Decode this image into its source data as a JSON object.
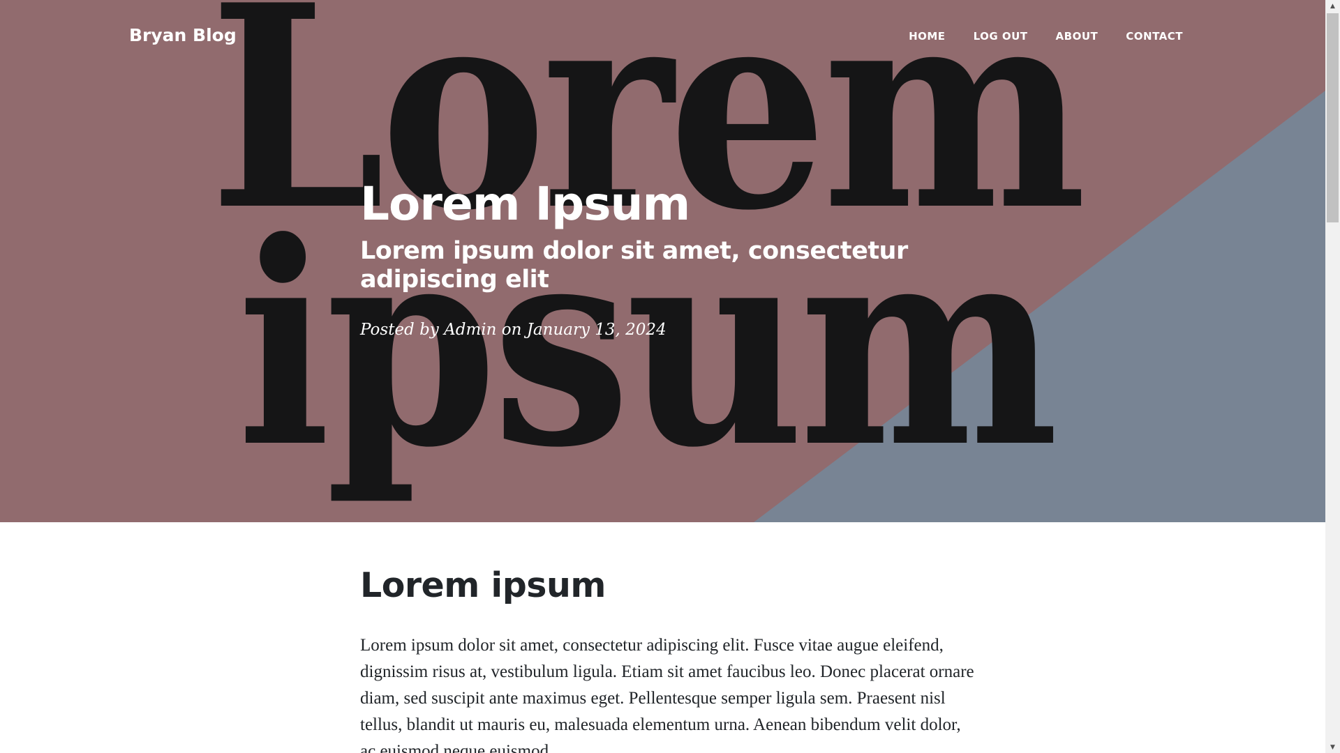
{
  "colors": {
    "hero_mauve": "#916B6E",
    "hero_slate": "#788494",
    "hero_letters": "#151516",
    "text_white": "#ffffff",
    "body_text": "#212529"
  },
  "hero_art": {
    "line1": "Lorem",
    "line2": "ipsum"
  },
  "navbar": {
    "brand": "Bryan Blog",
    "links": [
      {
        "label": "HOME"
      },
      {
        "label": "LOG OUT"
      },
      {
        "label": "ABOUT"
      },
      {
        "label": "CONTACT"
      }
    ]
  },
  "post": {
    "title": "Lorem Ipsum",
    "subtitle": "Lorem ipsum dolor sit amet, consectetur adipiscing elit",
    "meta": "Posted by Admin on January 13, 2024"
  },
  "content": {
    "heading": "Lorem ipsum",
    "paragraph": "Lorem ipsum dolor sit amet, consectetur adipiscing elit. Fusce vitae augue eleifend, dignissim risus at, vestibulum ligula. Etiam sit amet faucibus leo. Donec placerat ornare diam, sed suscipit ante maximus eget. Pellentesque semper ligula sem. Praesent nisl tellus, blandit ut mauris eu, malesuada elementum urna. Aenean bibendum velit dolor, ac euismod neque euismod"
  },
  "scrollbar": {
    "up_icon": "triangle-up-icon",
    "down_icon": "triangle-down-icon"
  }
}
